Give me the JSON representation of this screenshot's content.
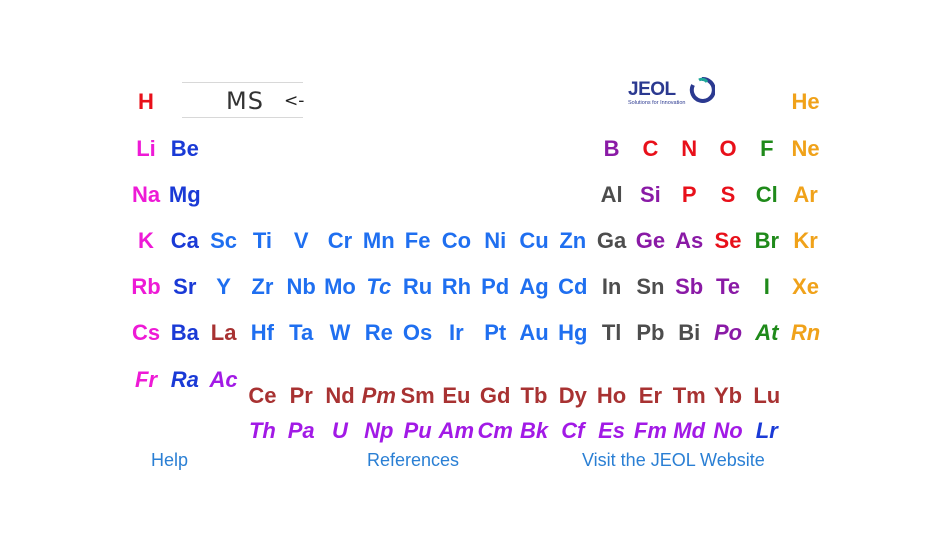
{
  "mode_box": {
    "label": "MS",
    "arrow": "<-"
  },
  "logo": {
    "brand": "JEOL",
    "tagline": "Solutions for Innovation"
  },
  "colors": {
    "red": "#e8101a",
    "magenta": "#ee1ad6",
    "blue": "#1a3ad6",
    "brightblue": "#1f6ff0",
    "purple": "#8a1aa6",
    "green": "#1f8a1a",
    "orange": "#f0a21a",
    "gray": "#4d4d4d",
    "brown": "#a83232",
    "violet": "#a21ae6"
  },
  "elements": [
    {
      "s": "H",
      "c": "red",
      "r": 0,
      "g": 0
    },
    {
      "s": "He",
      "c": "orange",
      "r": 0,
      "g": 17
    },
    {
      "s": "Li",
      "c": "magenta",
      "r": 1,
      "g": 0
    },
    {
      "s": "Be",
      "c": "blue",
      "r": 1,
      "g": 1
    },
    {
      "s": "B",
      "c": "purple",
      "r": 1,
      "g": 12
    },
    {
      "s": "C",
      "c": "red",
      "r": 1,
      "g": 13
    },
    {
      "s": "N",
      "c": "red",
      "r": 1,
      "g": 14
    },
    {
      "s": "O",
      "c": "red",
      "r": 1,
      "g": 15
    },
    {
      "s": "F",
      "c": "green",
      "r": 1,
      "g": 16
    },
    {
      "s": "Ne",
      "c": "orange",
      "r": 1,
      "g": 17
    },
    {
      "s": "Na",
      "c": "magenta",
      "r": 2,
      "g": 0
    },
    {
      "s": "Mg",
      "c": "blue",
      "r": 2,
      "g": 1
    },
    {
      "s": "Al",
      "c": "gray",
      "r": 2,
      "g": 12
    },
    {
      "s": "Si",
      "c": "purple",
      "r": 2,
      "g": 13
    },
    {
      "s": "P",
      "c": "red",
      "r": 2,
      "g": 14
    },
    {
      "s": "S",
      "c": "red",
      "r": 2,
      "g": 15
    },
    {
      "s": "Cl",
      "c": "green",
      "r": 2,
      "g": 16
    },
    {
      "s": "Ar",
      "c": "orange",
      "r": 2,
      "g": 17
    },
    {
      "s": "K",
      "c": "magenta",
      "r": 3,
      "g": 0
    },
    {
      "s": "Ca",
      "c": "blue",
      "r": 3,
      "g": 1
    },
    {
      "s": "Sc",
      "c": "brightblue",
      "r": 3,
      "g": 2
    },
    {
      "s": "Ti",
      "c": "brightblue",
      "r": 3,
      "g": 3
    },
    {
      "s": "V",
      "c": "brightblue",
      "r": 3,
      "g": 4
    },
    {
      "s": "Cr",
      "c": "brightblue",
      "r": 3,
      "g": 5
    },
    {
      "s": "Mn",
      "c": "brightblue",
      "r": 3,
      "g": 6
    },
    {
      "s": "Fe",
      "c": "brightblue",
      "r": 3,
      "g": 7
    },
    {
      "s": "Co",
      "c": "brightblue",
      "r": 3,
      "g": 8
    },
    {
      "s": "Ni",
      "c": "brightblue",
      "r": 3,
      "g": 9
    },
    {
      "s": "Cu",
      "c": "brightblue",
      "r": 3,
      "g": 10
    },
    {
      "s": "Zn",
      "c": "brightblue",
      "r": 3,
      "g": 11
    },
    {
      "s": "Ga",
      "c": "gray",
      "r": 3,
      "g": 12
    },
    {
      "s": "Ge",
      "c": "purple",
      "r": 3,
      "g": 13
    },
    {
      "s": "As",
      "c": "purple",
      "r": 3,
      "g": 14
    },
    {
      "s": "Se",
      "c": "red",
      "r": 3,
      "g": 15
    },
    {
      "s": "Br",
      "c": "green",
      "r": 3,
      "g": 16
    },
    {
      "s": "Kr",
      "c": "orange",
      "r": 3,
      "g": 17
    },
    {
      "s": "Rb",
      "c": "magenta",
      "r": 4,
      "g": 0
    },
    {
      "s": "Sr",
      "c": "blue",
      "r": 4,
      "g": 1
    },
    {
      "s": "Y",
      "c": "brightblue",
      "r": 4,
      "g": 2
    },
    {
      "s": "Zr",
      "c": "brightblue",
      "r": 4,
      "g": 3
    },
    {
      "s": "Nb",
      "c": "brightblue",
      "r": 4,
      "g": 4
    },
    {
      "s": "Mo",
      "c": "brightblue",
      "r": 4,
      "g": 5
    },
    {
      "s": "Tc",
      "c": "brightblue",
      "r": 4,
      "g": 6,
      "i": true
    },
    {
      "s": "Ru",
      "c": "brightblue",
      "r": 4,
      "g": 7
    },
    {
      "s": "Rh",
      "c": "brightblue",
      "r": 4,
      "g": 8
    },
    {
      "s": "Pd",
      "c": "brightblue",
      "r": 4,
      "g": 9
    },
    {
      "s": "Ag",
      "c": "brightblue",
      "r": 4,
      "g": 10
    },
    {
      "s": "Cd",
      "c": "brightblue",
      "r": 4,
      "g": 11
    },
    {
      "s": "In",
      "c": "gray",
      "r": 4,
      "g": 12
    },
    {
      "s": "Sn",
      "c": "gray",
      "r": 4,
      "g": 13
    },
    {
      "s": "Sb",
      "c": "purple",
      "r": 4,
      "g": 14
    },
    {
      "s": "Te",
      "c": "purple",
      "r": 4,
      "g": 15
    },
    {
      "s": "I",
      "c": "green",
      "r": 4,
      "g": 16
    },
    {
      "s": "Xe",
      "c": "orange",
      "r": 4,
      "g": 17
    },
    {
      "s": "Cs",
      "c": "magenta",
      "r": 5,
      "g": 0
    },
    {
      "s": "Ba",
      "c": "blue",
      "r": 5,
      "g": 1
    },
    {
      "s": "La",
      "c": "brown",
      "r": 5,
      "g": 2
    },
    {
      "s": "Hf",
      "c": "brightblue",
      "r": 5,
      "g": 3
    },
    {
      "s": "Ta",
      "c": "brightblue",
      "r": 5,
      "g": 4
    },
    {
      "s": "W",
      "c": "brightblue",
      "r": 5,
      "g": 5
    },
    {
      "s": "Re",
      "c": "brightblue",
      "r": 5,
      "g": 6
    },
    {
      "s": "Os",
      "c": "brightblue",
      "r": 5,
      "g": 7
    },
    {
      "s": "Ir",
      "c": "brightblue",
      "r": 5,
      "g": 8
    },
    {
      "s": "Pt",
      "c": "brightblue",
      "r": 5,
      "g": 9
    },
    {
      "s": "Au",
      "c": "brightblue",
      "r": 5,
      "g": 10
    },
    {
      "s": "Hg",
      "c": "brightblue",
      "r": 5,
      "g": 11
    },
    {
      "s": "Tl",
      "c": "gray",
      "r": 5,
      "g": 12
    },
    {
      "s": "Pb",
      "c": "gray",
      "r": 5,
      "g": 13
    },
    {
      "s": "Bi",
      "c": "gray",
      "r": 5,
      "g": 14
    },
    {
      "s": "Po",
      "c": "purple",
      "r": 5,
      "g": 15,
      "i": true
    },
    {
      "s": "At",
      "c": "green",
      "r": 5,
      "g": 16,
      "i": true
    },
    {
      "s": "Rn",
      "c": "orange",
      "r": 5,
      "g": 17,
      "i": true
    },
    {
      "s": "Fr",
      "c": "magenta",
      "r": 6,
      "g": 0,
      "i": true
    },
    {
      "s": "Ra",
      "c": "blue",
      "r": 6,
      "g": 1,
      "i": true
    },
    {
      "s": "Ac",
      "c": "violet",
      "r": 6,
      "g": 2,
      "i": true
    },
    {
      "s": "Ce",
      "c": "brown",
      "r": 7,
      "g": 3
    },
    {
      "s": "Pr",
      "c": "brown",
      "r": 7,
      "g": 4
    },
    {
      "s": "Nd",
      "c": "brown",
      "r": 7,
      "g": 5
    },
    {
      "s": "Pm",
      "c": "brown",
      "r": 7,
      "g": 6,
      "i": true
    },
    {
      "s": "Sm",
      "c": "brown",
      "r": 7,
      "g": 7
    },
    {
      "s": "Eu",
      "c": "brown",
      "r": 7,
      "g": 8
    },
    {
      "s": "Gd",
      "c": "brown",
      "r": 7,
      "g": 9
    },
    {
      "s": "Tb",
      "c": "brown",
      "r": 7,
      "g": 10
    },
    {
      "s": "Dy",
      "c": "brown",
      "r": 7,
      "g": 11
    },
    {
      "s": "Ho",
      "c": "brown",
      "r": 7,
      "g": 12
    },
    {
      "s": "Er",
      "c": "brown",
      "r": 7,
      "g": 13
    },
    {
      "s": "Tm",
      "c": "brown",
      "r": 7,
      "g": 14
    },
    {
      "s": "Yb",
      "c": "brown",
      "r": 7,
      "g": 15
    },
    {
      "s": "Lu",
      "c": "brown",
      "r": 7,
      "g": 16
    },
    {
      "s": "Th",
      "c": "violet",
      "r": 8,
      "g": 3,
      "i": true
    },
    {
      "s": "Pa",
      "c": "violet",
      "r": 8,
      "g": 4,
      "i": true
    },
    {
      "s": "U",
      "c": "violet",
      "r": 8,
      "g": 5,
      "i": true
    },
    {
      "s": "Np",
      "c": "violet",
      "r": 8,
      "g": 6,
      "i": true
    },
    {
      "s": "Pu",
      "c": "violet",
      "r": 8,
      "g": 7,
      "i": true
    },
    {
      "s": "Am",
      "c": "violet",
      "r": 8,
      "g": 8,
      "i": true
    },
    {
      "s": "Cm",
      "c": "violet",
      "r": 8,
      "g": 9,
      "i": true
    },
    {
      "s": "Bk",
      "c": "violet",
      "r": 8,
      "g": 10,
      "i": true
    },
    {
      "s": "Cf",
      "c": "violet",
      "r": 8,
      "g": 11,
      "i": true
    },
    {
      "s": "Es",
      "c": "violet",
      "r": 8,
      "g": 12,
      "i": true
    },
    {
      "s": "Fm",
      "c": "violet",
      "r": 8,
      "g": 13,
      "i": true
    },
    {
      "s": "Md",
      "c": "violet",
      "r": 8,
      "g": 14,
      "i": true
    },
    {
      "s": "No",
      "c": "violet",
      "r": 8,
      "g": 15,
      "i": true
    },
    {
      "s": "Lr",
      "c": "blue",
      "r": 8,
      "g": 16,
      "i": true
    }
  ],
  "links": {
    "help": "Help",
    "references": "References",
    "website": "Visit the JEOL Website"
  }
}
